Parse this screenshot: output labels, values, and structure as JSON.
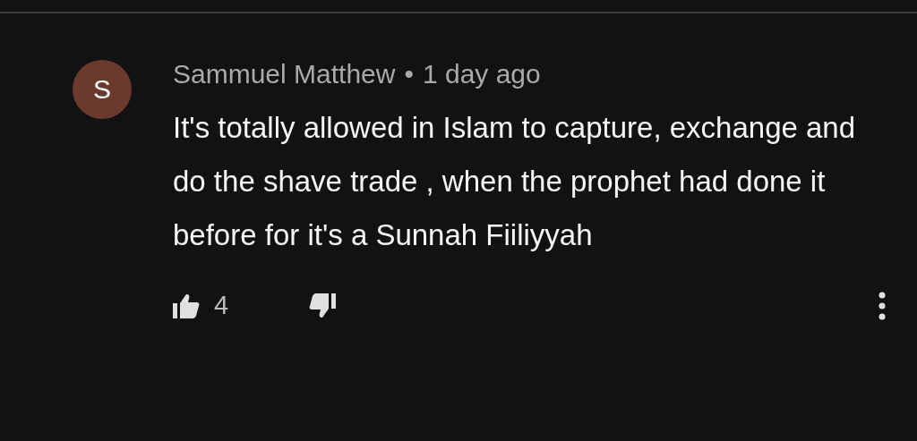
{
  "comment": {
    "avatar_letter": "S",
    "author": "Sammuel Matthew",
    "separator": "•",
    "time": "1 day ago",
    "text": "It's totally allowed in Islam to capture, exchange and do the shave trade , when the prophet had done it before for it's a Sunnah Fiiliyyah",
    "likes": "4"
  }
}
